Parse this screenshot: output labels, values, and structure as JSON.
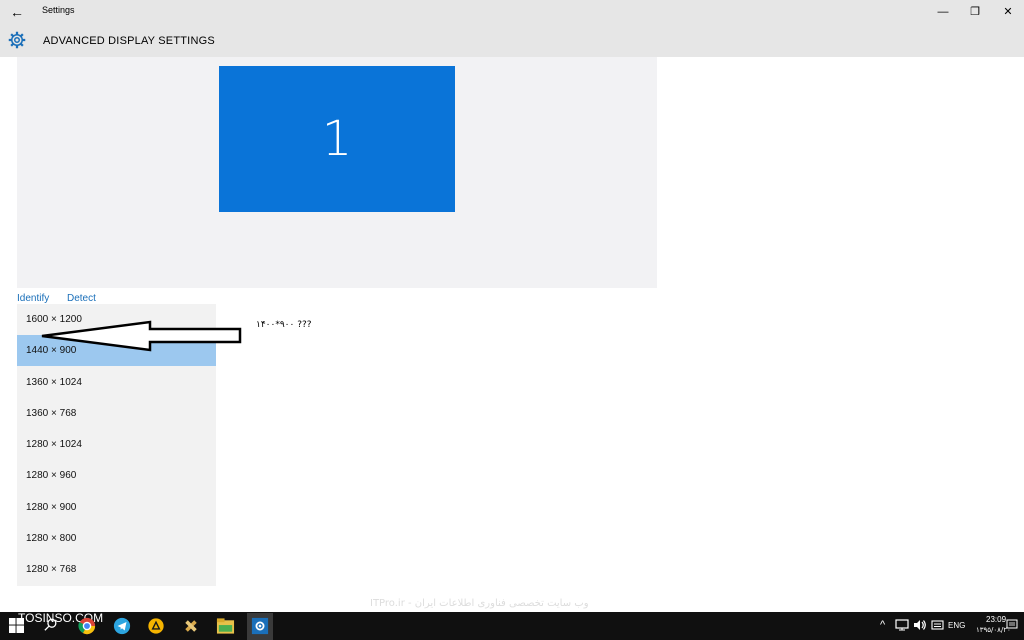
{
  "window": {
    "title": "Settings",
    "back_icon": "back-arrow-icon",
    "minimize_glyph": "—",
    "restore_glyph": "❐",
    "close_glyph": "✕"
  },
  "header": {
    "title": "ADVANCED DISPLAY SETTINGS",
    "icon": "gear-icon",
    "accent": "#1a6fb9"
  },
  "monitor": {
    "label": "1",
    "color": "#0a74d8"
  },
  "links": {
    "identify": "Identify",
    "detect": "Detect"
  },
  "resolution_dropdown": {
    "selected_index": 1,
    "options": [
      "1600 × 1200",
      "1440 × 900",
      "1360 × 1024",
      "1360 × 768",
      "1280 × 1024",
      "1280 × 960",
      "1280 × 900",
      "1280 × 800",
      "1280 × 768"
    ]
  },
  "annotation": {
    "text": "۱۴۰۰*۹۰۰ ???"
  },
  "watermark": {
    "text": "ITPro.ir - وب سایت تخصصی فناوری اطلاعات ایران",
    "logo": "TOSINSO.COM"
  },
  "taskbar": {
    "icons": [
      "start-icon",
      "search-icon",
      "chrome-icon",
      "telegram-icon",
      "app-icon",
      "tools-icon",
      "file-explorer-icon",
      "settings-icon"
    ],
    "tray": {
      "chevron": "^",
      "language": "ENG",
      "time": "23:09",
      "date": "۱۳۹۵/۰۸/۲۰"
    }
  }
}
